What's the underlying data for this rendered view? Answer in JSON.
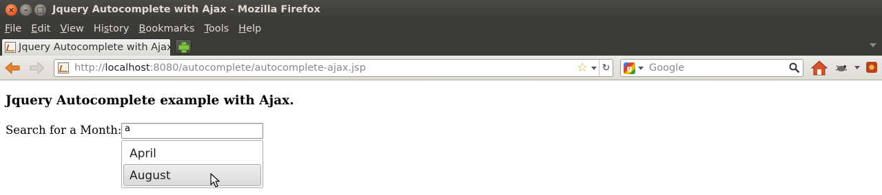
{
  "window": {
    "title": "Jquery Autocomplete with Ajax - Mozilla Firefox",
    "buttons": {
      "close": "×",
      "minimize": "–",
      "maximize": "□"
    }
  },
  "menu": {
    "items": [
      {
        "accel": "F",
        "rest": "ile"
      },
      {
        "accel": "E",
        "rest": "dit"
      },
      {
        "accel": "V",
        "rest": "iew"
      },
      {
        "pre": "Hi",
        "accel": "s",
        "rest": "tory"
      },
      {
        "accel": "B",
        "rest": "ookmarks"
      },
      {
        "accel": "T",
        "rest": "ools"
      },
      {
        "accel": "H",
        "rest": "elp"
      }
    ]
  },
  "tabs": [
    {
      "label": "Jquery Autocomplete with Ajax",
      "active": true
    }
  ],
  "navbar": {
    "url_scheme": "http://",
    "url_host": "localhost",
    "url_path": ":8080/autocomplete/autocomplete-ajax.jsp",
    "search_engine": "Google",
    "search_placeholder": "Google",
    "reload_glyph": "↻",
    "star_glyph": "☆"
  },
  "icons": {
    "back": "back-arrow-icon",
    "forward": "forward-arrow-icon",
    "bookmark": "star-icon",
    "reload": "reload-icon",
    "search": "magnifier-icon",
    "home": "home-icon",
    "addon": "addon-icon",
    "bug": "bug-icon"
  },
  "colors": {
    "chrome_dark": "#3c3b37",
    "back_arrow": "#e8842b",
    "home": "#d3542a",
    "menu_highlight": "#dadada"
  },
  "page": {
    "heading": "Jquery Autocomplete example with Ajax.",
    "search_label": "Search for a Month:",
    "search_value": "a",
    "suggestions": [
      {
        "label": "April",
        "active": false
      },
      {
        "label": "August",
        "active": true
      }
    ]
  }
}
